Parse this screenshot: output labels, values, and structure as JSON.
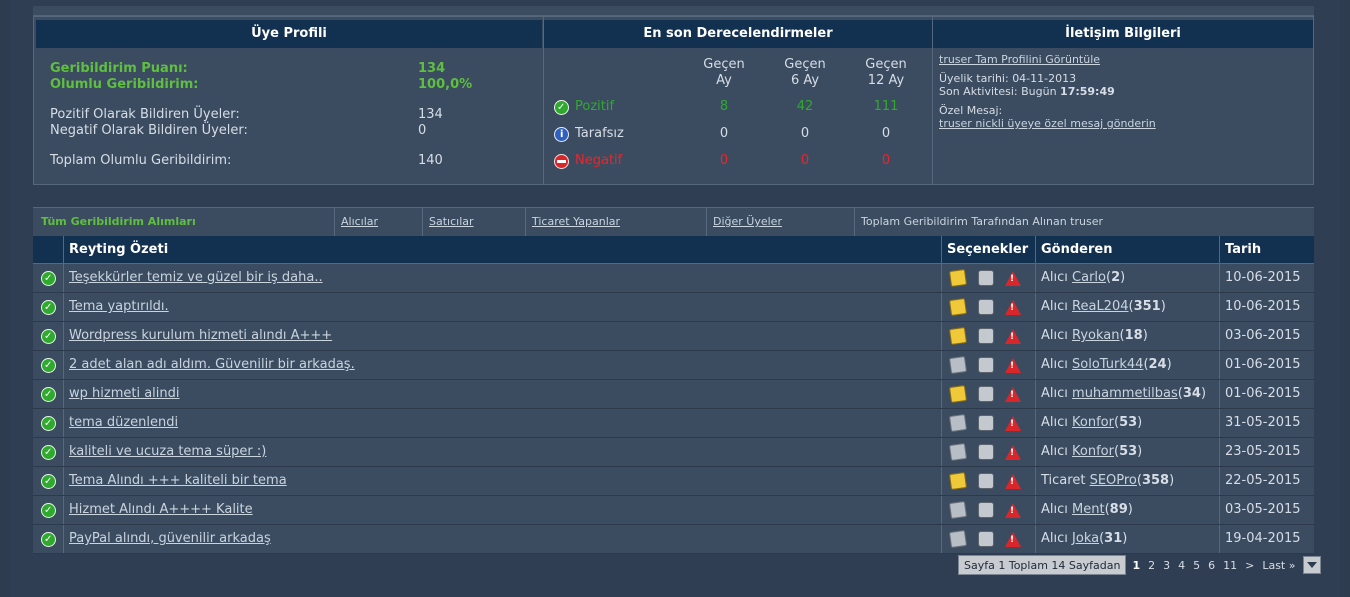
{
  "profile": {
    "header": "Üye Profili",
    "feedback_score_label": "Geribildirim Puanı:",
    "feedback_score": "134",
    "positive_label": "Olumlu Geribildirim:",
    "positive_value": "100,0%",
    "positive_members_label": "Pozitif Olarak Bildiren Üyeler:",
    "positive_members": "134",
    "negative_members_label": "Negatif Olarak Bildiren Üyeler:",
    "negative_members": "0",
    "total_label": "Toplam Olumlu Geribildirim:",
    "total": "140"
  },
  "ratings": {
    "header": "En son Derecelendirmeler",
    "periods": [
      {
        "line1": "Geçen",
        "line2": "Ay"
      },
      {
        "line1": "Geçen",
        "line2": "6 Ay"
      },
      {
        "line1": "Geçen",
        "line2": "12 Ay"
      }
    ],
    "rows": [
      {
        "label": "Pozitif",
        "values": [
          "8",
          "42",
          "111"
        ],
        "color": "#2faa2f"
      },
      {
        "label": "Tarafsız",
        "values": [
          "0",
          "0",
          "0"
        ],
        "color": "#d6dde6"
      },
      {
        "label": "Negatif",
        "values": [
          "0",
          "0",
          "0"
        ],
        "color": "#e8262b"
      }
    ]
  },
  "contact": {
    "header": "İletişim Bilgileri",
    "profile_link": "truser Tam Profilini Görüntüle",
    "member_since_label": "Üyelik tarihi:",
    "member_since": "04-11-2013",
    "last_activity_label": "Son Aktivitesi:",
    "last_activity_day": "Bugün",
    "last_activity_time": "17:59:49",
    "pm_label": "Özel Mesaj:",
    "pm_link": "truser nickli üyeye özel mesaj gönderin"
  },
  "tabs": {
    "all": "Tüm Geribildirim Alımları",
    "buyers": "Alıcılar",
    "sellers": "Satıcılar",
    "traders": "Ticaret Yapanlar",
    "others": "Diğer Üyeler",
    "info": "Toplam Geribildirim Tarafından Alınan truser"
  },
  "table": {
    "headers": {
      "summary": "Reyting Özeti",
      "options": "Seçenekler",
      "sender": "Gönderen",
      "date": "Tarih"
    },
    "rows": [
      {
        "summary": "Teşekkürler temiz ve güzel bir iş daha..",
        "note": "yellow",
        "role": "Alıcı",
        "user": "Carlo",
        "score": "2",
        "date": "10-06-2015"
      },
      {
        "summary": "Tema yaptırıldı.",
        "note": "yellow",
        "role": "Alıcı",
        "user": "ReaL204",
        "score": "351",
        "date": "10-06-2015"
      },
      {
        "summary": "Wordpress kurulum hizmeti alındı A+++",
        "note": "yellow",
        "role": "Alıcı",
        "user": "Ryokan",
        "score": "18",
        "date": "03-06-2015"
      },
      {
        "summary": "2 adet alan adı aldım. Güvenilir bir arkadaş.",
        "note": "gray",
        "role": "Alıcı",
        "user": "SoloTurk44",
        "score": "24",
        "date": "01-06-2015"
      },
      {
        "summary": "wp hizmeti alindi",
        "note": "yellow",
        "role": "Alıcı",
        "user": "muhammetilbas",
        "score": "34",
        "date": "01-06-2015"
      },
      {
        "summary": "tema düzenlendi",
        "note": "gray",
        "role": "Alıcı",
        "user": "Konfor",
        "score": "53",
        "date": "31-05-2015"
      },
      {
        "summary": "kaliteli ve ucuza tema süper :)",
        "note": "gray",
        "role": "Alıcı",
        "user": "Konfor",
        "score": "53",
        "date": "23-05-2015"
      },
      {
        "summary": "Tema Alındı +++ kaliteli bir tema",
        "note": "yellow",
        "role": "Ticaret",
        "user": "SEOPro",
        "score": "358",
        "date": "22-05-2015"
      },
      {
        "summary": "Hizmet Alındı A++++ Kalite",
        "note": "gray",
        "role": "Alıcı",
        "user": "Ment",
        "score": "89",
        "date": "03-05-2015"
      },
      {
        "summary": "PayPal alındı, güvenilir arkadaş",
        "note": "gray",
        "role": "Alıcı",
        "user": "Joka",
        "score": "31",
        "date": "19-04-2015"
      }
    ]
  },
  "pager": {
    "label": "Sayfa 1 Toplam 14 Sayfadan",
    "current": "1",
    "pages": [
      "2",
      "3",
      "4",
      "5",
      "6",
      "11"
    ],
    "next": ">",
    "last": "Last »"
  },
  "colors": {
    "header_bg": "#12304f",
    "panel_bg": "#3b4c61",
    "green": "#5fbf3f",
    "red": "#e8262b"
  }
}
